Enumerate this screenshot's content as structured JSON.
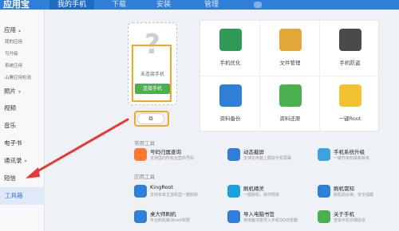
{
  "app": {
    "brand": "应用宝",
    "top_tabs": [
      "我的手机",
      "下载",
      "安装",
      "管理"
    ]
  },
  "sidebar": {
    "sections": [
      {
        "label": "应用",
        "sub": [
          "我的应用",
          "可升级",
          "系统应用",
          "山寨应用检测"
        ]
      },
      {
        "label": "照片"
      },
      {
        "label": "视频"
      },
      {
        "label": "音乐"
      },
      {
        "label": "电子书"
      },
      {
        "label": "通讯录"
      },
      {
        "label": "短信"
      },
      {
        "label": "工具箱"
      }
    ]
  },
  "phone": {
    "status": "未连接手机",
    "connect_label": "连接手机",
    "control_glyph": "⧉"
  },
  "features": [
    {
      "label": "手机优化",
      "color": "#2e9a55"
    },
    {
      "label": "文件管理",
      "color": "#e1a73a"
    },
    {
      "label": "手机防盗",
      "color": "#4a4a4a"
    },
    {
      "label": "资料备份",
      "color": "#2f7ed8"
    },
    {
      "label": "资料还原",
      "color": "#4caf50"
    },
    {
      "label": "一键Root",
      "color": "#f3c233"
    }
  ],
  "common_tools": {
    "heading": "常用工具",
    "items": [
      {
        "name": "号码归属查询",
        "desc": "支持国内所有运营商号码",
        "color": "#ff7a2e"
      },
      {
        "name": "动态截屏",
        "desc": "支持在电脑上截取手机屏幕",
        "color": "#2f7ed8"
      },
      {
        "name": "手机系统升级",
        "desc": "一键升级到最新版本",
        "color": "#3aa3e0"
      }
    ]
  },
  "app_tools": {
    "heading": "应用工具",
    "items": [
      {
        "name": "KingRoot",
        "desc": "支持安卓主流机型一键获取",
        "color": "#2f7ed8"
      },
      {
        "name": "刷机精灵",
        "desc": "一键刷机，操作简单",
        "color": "#1ea1e0"
      },
      {
        "name": "刷机需知",
        "desc": "刷机前必读，安全提醒",
        "color": "#2f7ed8"
      },
      {
        "name": "桌大师刷机",
        "desc": "专业刷机解决root权限",
        "color": "#2f7ed8"
      },
      {
        "name": "导入电脑书签",
        "desc": "将电脑书签导入手机QQ浏览器",
        "color": "#2f7ed8"
      },
      {
        "name": "关于手机",
        "desc": "查看手机详细信息",
        "color": "#4caf50"
      }
    ]
  }
}
